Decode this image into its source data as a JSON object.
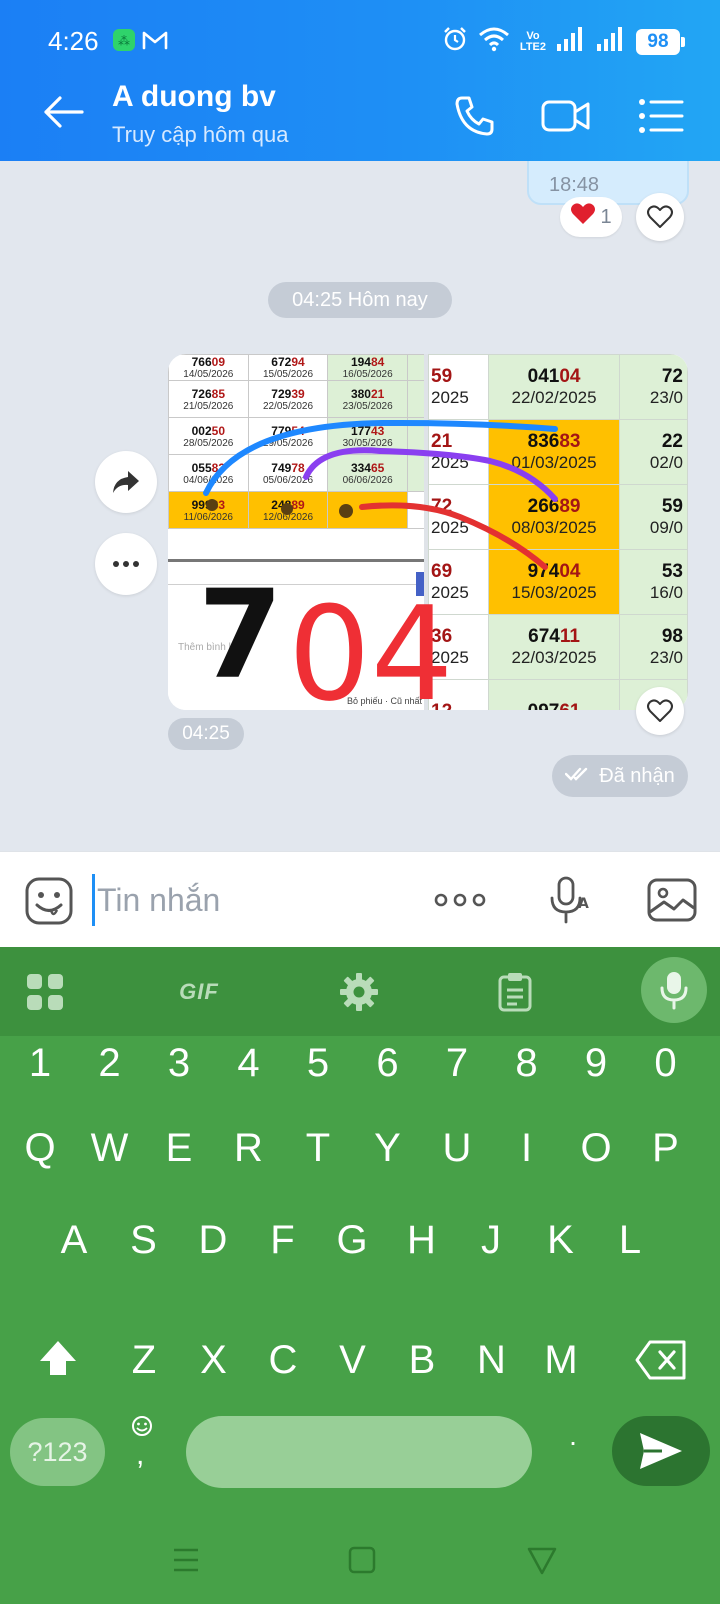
{
  "status_bar": {
    "time": "4:26",
    "volte_top": "Vo",
    "volte_bottom": "LTE2",
    "battery": "98"
  },
  "header": {
    "title": "A duong bv",
    "subtitle": "Truy cập hôm qua"
  },
  "chat": {
    "previous_message_time": "18:48",
    "reaction_count": "1",
    "date_separator": "04:25 Hôm nay",
    "message_time": "04:25",
    "delivery_status": "Đã nhận"
  },
  "photo": {
    "left_table_rows": [
      {
        "cells": [
          {
            "num_a": "766",
            "num_b": "09",
            "date": "14/05/2026"
          },
          {
            "num_a": "672",
            "num_b": "94",
            "date": "15/05/2026"
          },
          {
            "num_a": "194",
            "num_b": "84",
            "date": "16/05/2026"
          }
        ]
      },
      {
        "cells": [
          {
            "num_a": "726",
            "num_b": "85",
            "date": "21/05/2026"
          },
          {
            "num_a": "729",
            "num_b": "39",
            "date": "22/05/2026"
          },
          {
            "num_a": "380",
            "num_b": "21",
            "date": "23/05/2026"
          }
        ]
      },
      {
        "cells": [
          {
            "num_a": "002",
            "num_b": "50",
            "date": "28/05/2026"
          },
          {
            "num_a": "779",
            "num_b": "54",
            "date": "29/05/2026"
          },
          {
            "num_a": "177",
            "num_b": "43",
            "date": "30/05/2026"
          }
        ]
      },
      {
        "cells": [
          {
            "num_a": "055",
            "num_b": "83",
            "date": "04/06/2026"
          },
          {
            "num_a": "749",
            "num_b": "78",
            "date": "05/06/2026"
          },
          {
            "num_a": "334",
            "num_b": "65",
            "date": "06/06/2026"
          }
        ]
      },
      {
        "cells": [
          {
            "num_a": "999",
            "num_b": "83",
            "date": "11/06/2026"
          },
          {
            "num_a": "248",
            "num_b": "89",
            "date": "12/06/2026"
          },
          {
            "num_a": "",
            "num_b": "",
            "date": ""
          }
        ]
      }
    ],
    "left_comment_placeholder": "Thêm bình luận",
    "left_footer": "Bỏ phiếu · Cũ nhất",
    "right_table_rows": [
      {
        "c1": "59",
        "c1_year": "2025",
        "num_a": "041",
        "num_b": "04",
        "date": "22/02/2025",
        "c3": "72",
        "c3_date": "23/0",
        "highlight": false
      },
      {
        "c1": "21",
        "c1_year": "2025",
        "num_a": "836",
        "num_b": "83",
        "date": "01/03/2025",
        "c3": "22",
        "c3_date": "02/0",
        "highlight": true
      },
      {
        "c1": "72",
        "c1_year": "2025",
        "num_a": "266",
        "num_b": "89",
        "date": "08/03/2025",
        "c3": "59",
        "c3_date": "09/0",
        "highlight": true
      },
      {
        "c1": "69",
        "c1_year": "2025",
        "num_a": "974",
        "num_b": "04",
        "date": "15/03/2025",
        "c3": "53",
        "c3_date": "16/0",
        "highlight": true
      },
      {
        "c1": "36",
        "c1_year": "2025",
        "num_a": "674",
        "num_b": "11",
        "date": "22/03/2025",
        "c3": "98",
        "c3_date": "23/0",
        "highlight": false
      },
      {
        "c1": "12",
        "c1_year": "",
        "num_a": "097",
        "num_b": "61",
        "date": "",
        "c3": "20",
        "c3_date": "",
        "highlight": false
      }
    ],
    "handwriting": {
      "black": "7",
      "red": "04"
    }
  },
  "input": {
    "placeholder": "Tin nhắn",
    "value": ""
  },
  "keyboard": {
    "gif_label": "GIF",
    "number_row": [
      "1",
      "2",
      "3",
      "4",
      "5",
      "6",
      "7",
      "8",
      "9",
      "0"
    ],
    "row1": [
      "Q",
      "W",
      "E",
      "R",
      "T",
      "Y",
      "U",
      "I",
      "O",
      "P"
    ],
    "row2": [
      "A",
      "S",
      "D",
      "F",
      "G",
      "H",
      "J",
      "K",
      "L"
    ],
    "row3": [
      "Z",
      "X",
      "C",
      "V",
      "B",
      "N",
      "M"
    ],
    "symbols_key": "?123",
    "comma_key": ",",
    "period_key": "."
  },
  "colors": {
    "header_blue": "#1e8ff5",
    "keyboard_green": "#47a148",
    "highlight_yellow": "#ffc000",
    "cell_green": "#ddf0d6",
    "number_red": "#a31515"
  }
}
